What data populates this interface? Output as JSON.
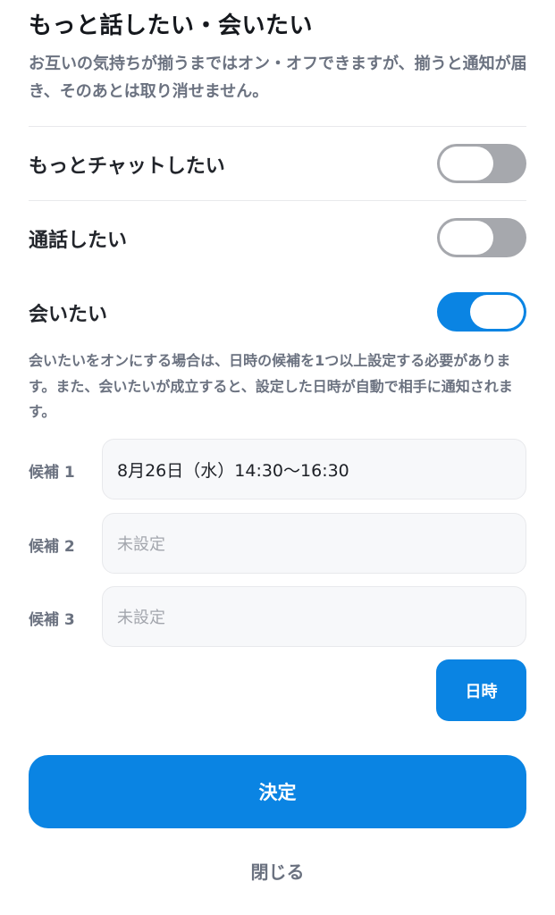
{
  "header": {
    "title": "もっと話したい・会いたい",
    "description": "お互いの気持ちが揃うまではオン・オフできますが、揃うと通知が届き、そのあとは取り消せません。"
  },
  "options": [
    {
      "label": "もっとチャットしたい",
      "on": false
    },
    {
      "label": "通話したい",
      "on": false
    },
    {
      "label": "会いたい",
      "on": true
    }
  ],
  "meet_note": "会いたいをオンにする場合は、日時の候補を1つ以上設定する必要があります。また、会いたいが成立すると、設定した日時が自動で相手に通知されます。",
  "candidates": [
    {
      "label": "候補 1",
      "value": "8月26日（水）14:30〜16:30",
      "placeholder": ""
    },
    {
      "label": "候補 2",
      "value": "",
      "placeholder": "未設定"
    },
    {
      "label": "候補 3",
      "value": "",
      "placeholder": "未設定"
    }
  ],
  "buttons": {
    "datetime": "日時",
    "decide": "決定",
    "close": "閉じる"
  },
  "colors": {
    "accent": "#0a84e3",
    "toggle_off": "#a6a8ad",
    "muted_text": "#6b7280"
  }
}
